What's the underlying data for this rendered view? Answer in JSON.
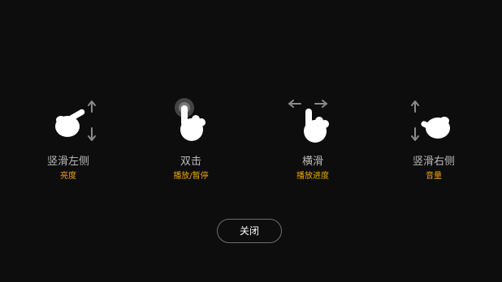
{
  "gestures": [
    {
      "icon": "swipe-vertical-left-hand-icon",
      "title": "竖滑左侧",
      "subtitle": "亮度"
    },
    {
      "icon": "double-tap-hand-icon",
      "title": "双击",
      "subtitle": "播放/暂停"
    },
    {
      "icon": "swipe-horizontal-hand-icon",
      "title": "横滑",
      "subtitle": "播放进度"
    },
    {
      "icon": "swipe-vertical-right-hand-icon",
      "title": "竖滑右侧",
      "subtitle": "音量"
    }
  ],
  "close_button": {
    "label": "关闭"
  },
  "colors": {
    "background": "#0d0d0d",
    "title": "#b9b9b9",
    "subtitle_accent": "#f0a800",
    "arrow": "#8a8a8a",
    "hand": "#ffffff",
    "button_border": "#6f6f6f"
  }
}
